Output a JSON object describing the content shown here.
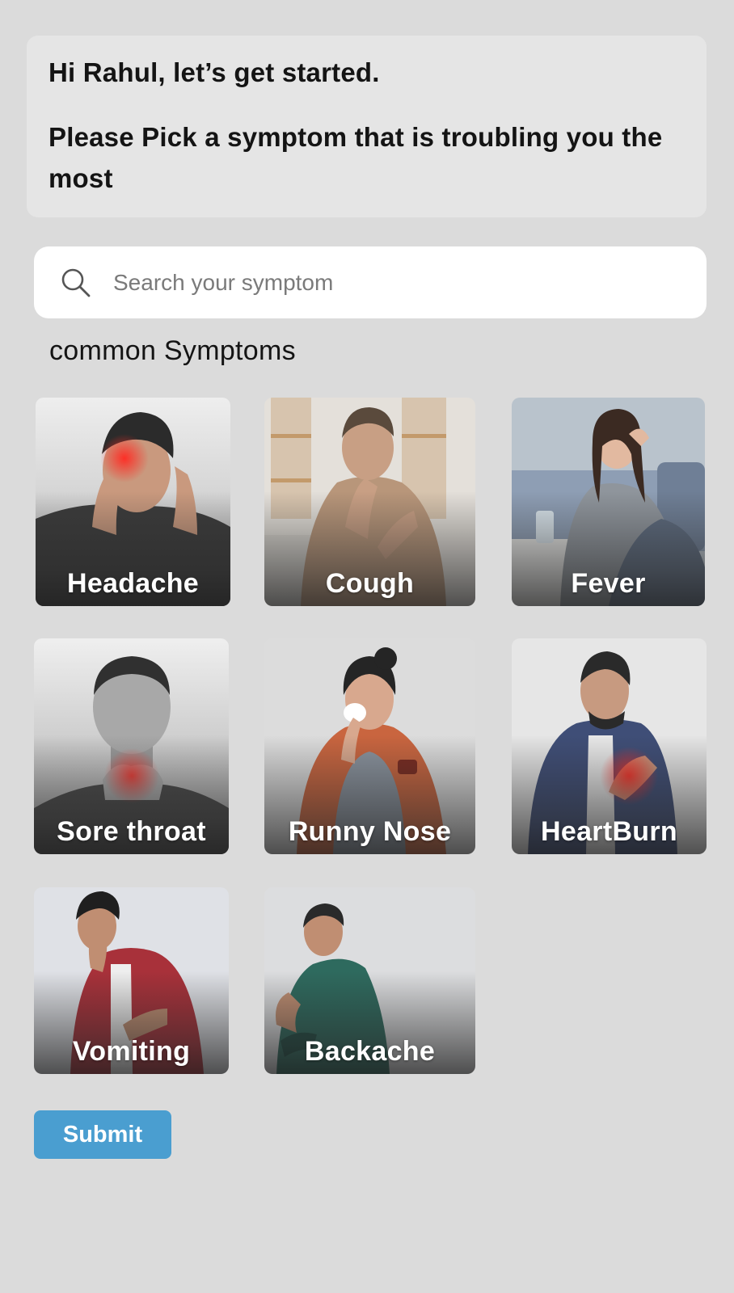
{
  "greeting": {
    "line1": "Hi Rahul, let’s get started.",
    "line2": "Please Pick a symptom that is troubling you the most"
  },
  "search": {
    "placeholder": "Search your symptom",
    "value": "",
    "icon": "search-icon"
  },
  "section": {
    "title": "common Symptoms"
  },
  "symptoms": [
    {
      "label": "Headache",
      "image": "man-holding-head-with-pain-highlight"
    },
    {
      "label": "Cough",
      "image": "man-coughing-in-living-room"
    },
    {
      "label": "Fever",
      "image": "woman-with-blanket-on-sofa"
    },
    {
      "label": "Sore throat",
      "image": "man-holding-throat-with-pain-highlight"
    },
    {
      "label": "Runny Nose",
      "image": "woman-with-tissue-and-tea"
    },
    {
      "label": "HeartBurn",
      "image": "man-holding-chest-with-pain-highlight"
    },
    {
      "label": "Vomiting",
      "image": "man-covering-mouth-nauseous"
    },
    {
      "label": "Backache",
      "image": "man-holding-lower-back"
    }
  ],
  "actions": {
    "submit_label": "Submit"
  },
  "colors": {
    "background": "#dbdbdb",
    "card": "#e5e5e5",
    "accent": "#4a9ed0",
    "pain_highlight": "#e8322e"
  }
}
